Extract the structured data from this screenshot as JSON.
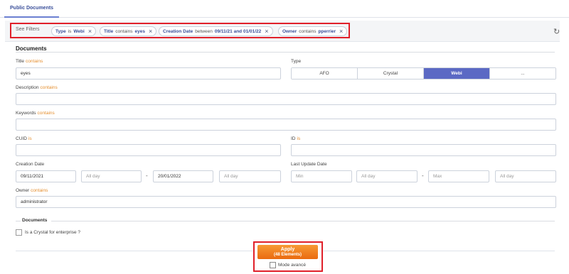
{
  "tabs": [
    "Public Documents"
  ],
  "filters": {
    "see_filters": "See Filters",
    "chips": [
      {
        "field": "Type",
        "op": "is",
        "value": "Webi"
      },
      {
        "field": "Title",
        "op": "contains",
        "value": "eyes"
      },
      {
        "field": "Creation Date",
        "op": "between",
        "value": "09/11/21 and 01/01/22"
      },
      {
        "field": "Owner",
        "op": "contains",
        "value": "pperrier"
      }
    ],
    "remove_glyph": "×",
    "refresh_glyph": "↻"
  },
  "form": {
    "section_title": "Documents",
    "title": {
      "label": "Title",
      "op": "contains",
      "value": "eyes"
    },
    "type": {
      "label": "Type",
      "options": [
        "AFO",
        "Crystal",
        "Webi",
        "..."
      ],
      "selected": "Webi"
    },
    "description": {
      "label": "Description",
      "op": "contains",
      "value": ""
    },
    "keywords": {
      "label": "Keywords",
      "op": "contains",
      "value": ""
    },
    "cuid": {
      "label": "CUID",
      "op": "is",
      "value": ""
    },
    "id": {
      "label": "ID",
      "op": "is",
      "value": ""
    },
    "creation_date": {
      "label": "Creation Date",
      "from": "09/11/2021",
      "from_time": "All day",
      "to": "20/01/2022",
      "to_time": "All day"
    },
    "last_update_date": {
      "label": "Last Update Date",
      "min": "Min",
      "min_time": "All day",
      "max": "Max",
      "max_time": "All day"
    },
    "range_dash": "-",
    "owner": {
      "label": "Owner",
      "op": "contains",
      "value": "administrator"
    },
    "documents_subsection": "Documents",
    "crystal_enterprise_label": "Is a Crystal for enterprise ?"
  },
  "footer": {
    "apply_label": "Apply",
    "apply_count": "(48 Elements)",
    "advanced_mode_label": "Mode avancé"
  },
  "colors": {
    "accent": "#5b69c4",
    "apply": "#f07d1e",
    "highlight": "#e0202a",
    "operator": "#e58f2f"
  }
}
